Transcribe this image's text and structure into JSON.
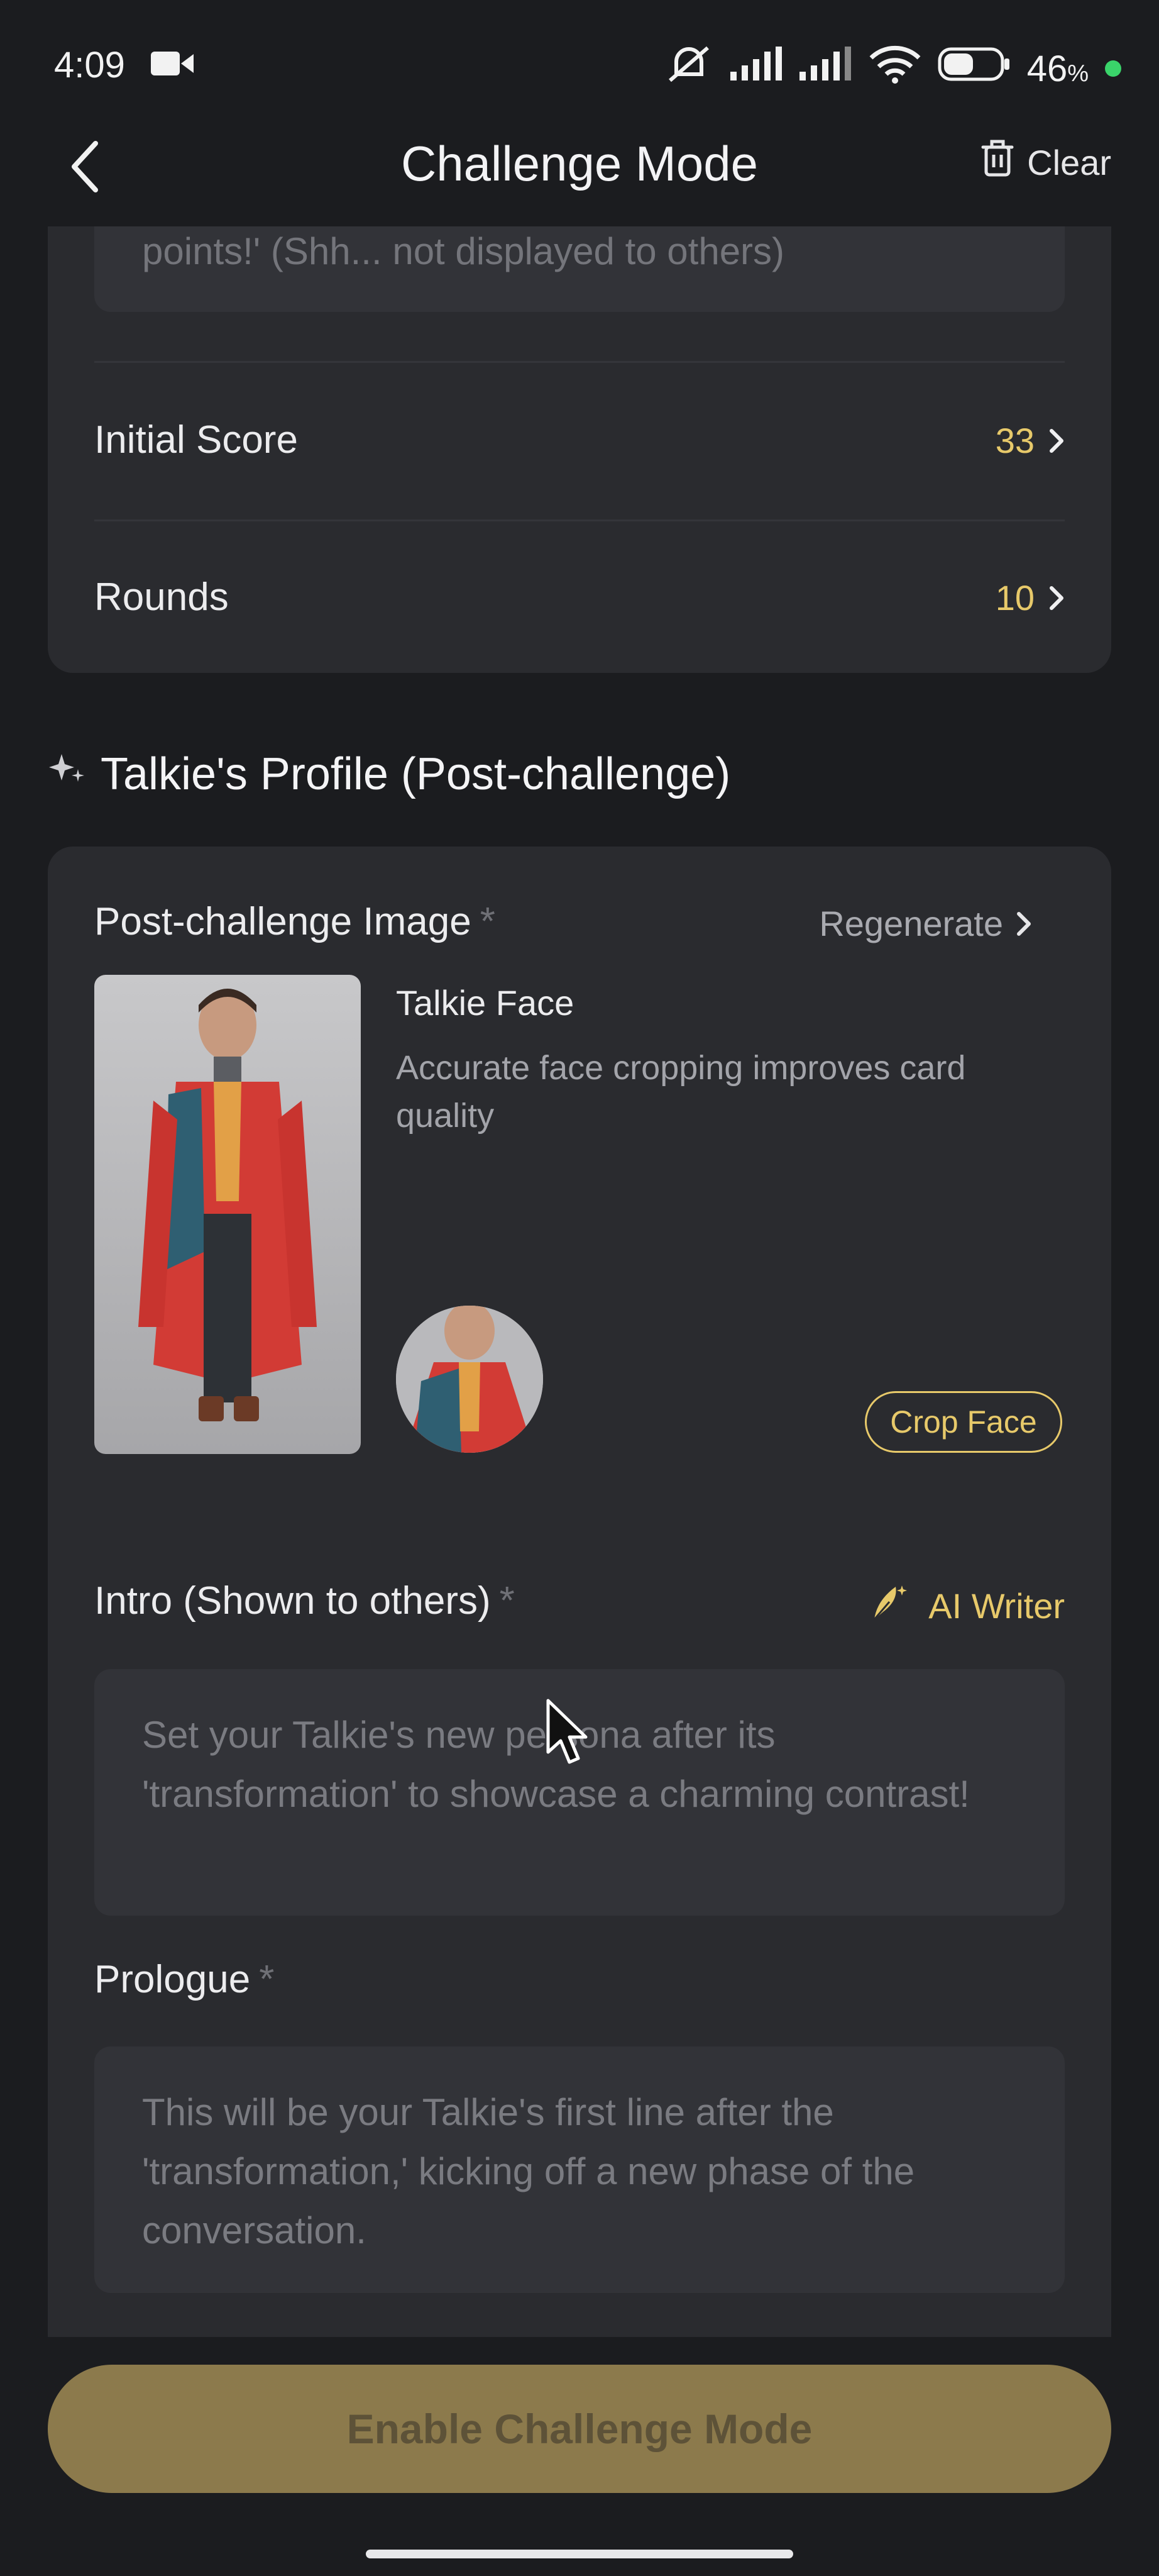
{
  "status": {
    "time": "4:09",
    "battery": "46"
  },
  "header": {
    "title": "Challenge Mode",
    "clear_label": "Clear"
  },
  "hidden_hint": "points!' (Shh... not displayed to others)",
  "settings": {
    "initial_score_label": "Initial Score",
    "initial_score_value": "33",
    "rounds_label": "Rounds",
    "rounds_value": "10"
  },
  "section": {
    "title": "Talkie's Profile (Post-challenge)"
  },
  "post_image": {
    "label": "Post-challenge Image",
    "regenerate_label": "Regenerate",
    "face_title": "Talkie Face",
    "face_desc": "Accurate face cropping improves card quality",
    "crop_label": "Crop Face"
  },
  "intro": {
    "label": "Intro (Shown to others)",
    "ai_writer_label": "AI Writer",
    "placeholder": "Set your Talkie's new persona after its 'transformation' to showcase a charming contrast!"
  },
  "prologue": {
    "label": "Prologue",
    "placeholder": "This will be your Talkie's first line after the 'transformation,' kicking off a new phase of the conversation."
  },
  "required_mark": "*",
  "enable_button_label": "Enable Challenge Mode",
  "colors": {
    "accent": "#e7c96a",
    "button_fill": "#8c7a4c",
    "background": "#1b1c1f",
    "card": "#2a2b2f"
  }
}
